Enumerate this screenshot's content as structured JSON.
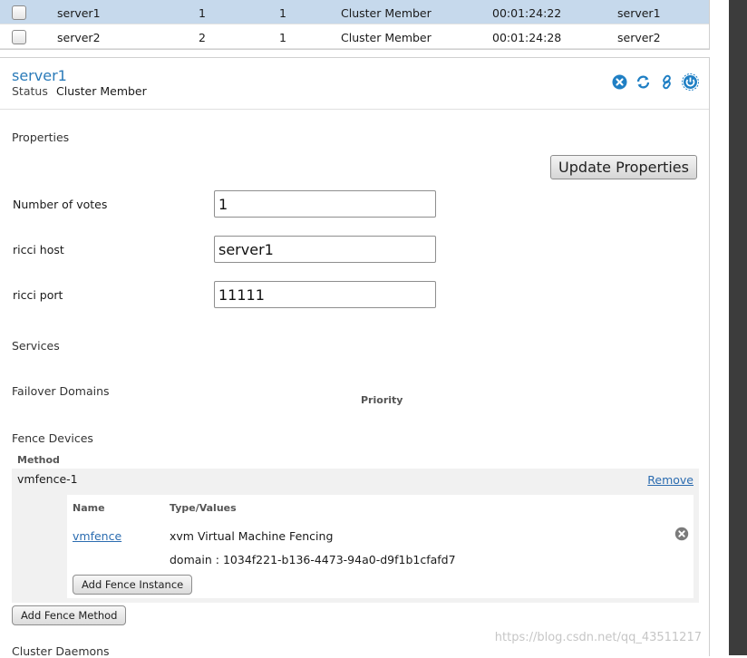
{
  "nodes_table": {
    "rows": [
      {
        "name": "server1",
        "node_id": "1",
        "votes": "1",
        "status": "Cluster Member",
        "uptime": "00:01:24:22",
        "hostname": "server1",
        "selected": true
      },
      {
        "name": "server2",
        "node_id": "2",
        "votes": "1",
        "status": "Cluster Member",
        "uptime": "00:01:24:28",
        "hostname": "server2",
        "selected": false
      }
    ]
  },
  "node": {
    "name": "server1",
    "status_label": "Status",
    "status_value": "Cluster Member"
  },
  "properties": {
    "section_title": "Properties",
    "update_button": "Update Properties",
    "votes_label": "Number of votes",
    "votes_value": "1",
    "ricci_host_label": "ricci host",
    "ricci_host_value": "server1",
    "ricci_port_label": "ricci port",
    "ricci_port_value": "11111"
  },
  "services": {
    "section_title": "Services"
  },
  "failover": {
    "section_title": "Failover Domains",
    "priority_header": "Priority"
  },
  "fence": {
    "section_title": "Fence Devices",
    "method_header": "Method",
    "method_name": "vmfence-1",
    "remove_label": "Remove",
    "name_header": "Name",
    "type_header": "Type/Values",
    "instance_name": "vmfence",
    "instance_type": "xvm Virtual Machine Fencing",
    "instance_domain": "domain : 1034f221-b136-4473-94a0-d9f1b1cfafd7",
    "add_instance_button": "Add Fence Instance",
    "add_method_button": "Add Fence Method"
  },
  "daemons": {
    "section_title": "Cluster Daemons"
  },
  "watermark": "https://blog.csdn.net/qq_43511217",
  "colors": {
    "link": "#2b7bb9",
    "selected_row": "#c6d9ec",
    "icon": "#1f7fc4"
  },
  "icons": [
    "close-icon",
    "refresh-icon",
    "link-icon",
    "power-icon",
    "remove-circle-icon"
  ]
}
